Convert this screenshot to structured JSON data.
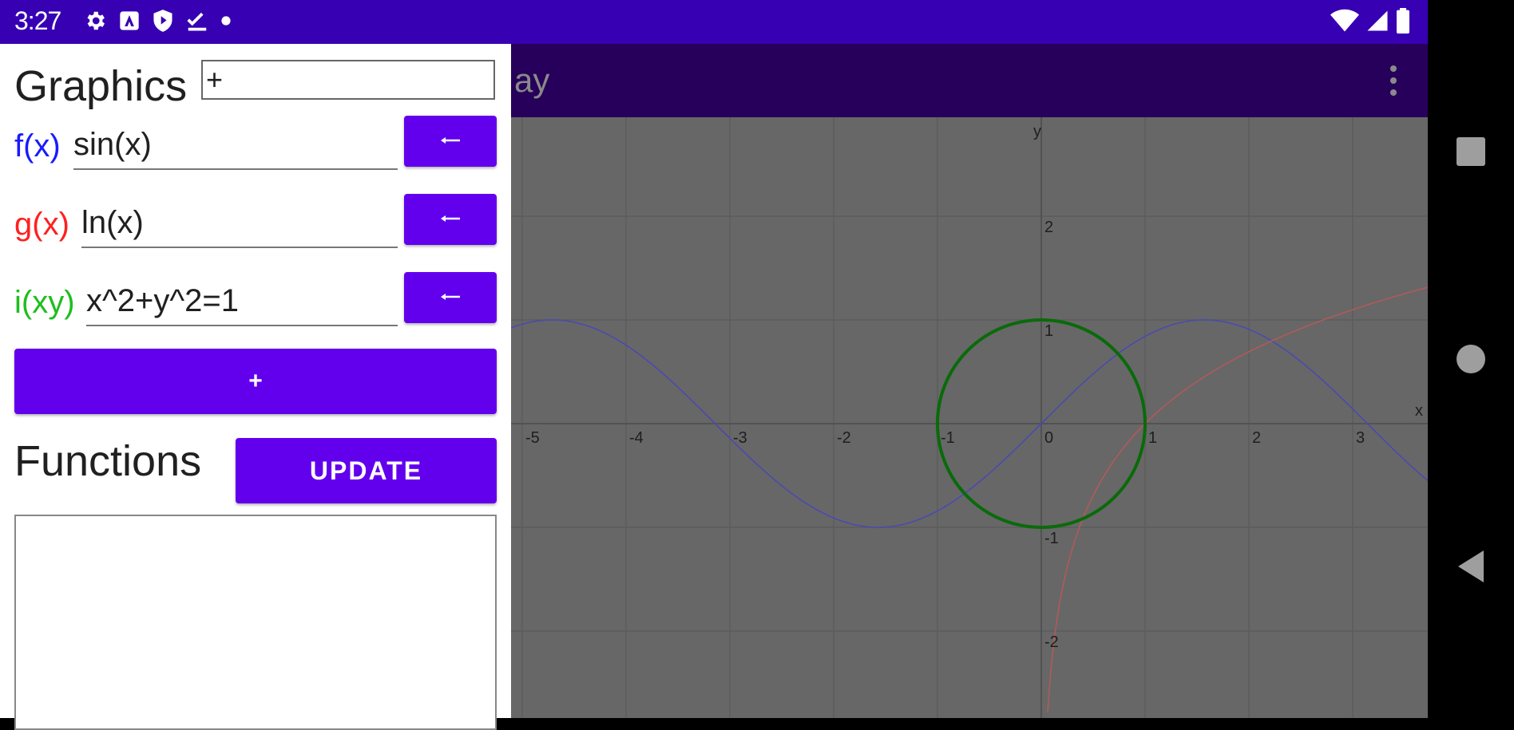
{
  "status_bar": {
    "time": "3:27",
    "left_icons": [
      "settings-icon",
      "a-badge-icon",
      "shield-play-icon",
      "check-download-icon",
      "dot-icon"
    ],
    "right_icons": [
      "wifi-icon",
      "signal-icon",
      "battery-icon"
    ]
  },
  "app_bar": {
    "title_partial": "ay",
    "menu_icon": "overflow-menu-icon"
  },
  "drawer": {
    "graphics_label": "Graphics",
    "graphics_input_value": "+",
    "functions": [
      {
        "name": "f(x)",
        "expression": "sin(x)",
        "color": "#1a1aff",
        "button_icon": "arrow-left-icon"
      },
      {
        "name": "g(x)",
        "expression": "ln(x)",
        "color": "#ff2020",
        "button_icon": "arrow-left-icon"
      },
      {
        "name": "i(xy)",
        "expression": "x^2+y^2=1",
        "color": "#1ebe1e",
        "button_icon": "arrow-left-icon"
      }
    ],
    "add_button_label": "+",
    "functions_heading": "Functions",
    "update_button_label": "UPDATE"
  },
  "graph": {
    "x_axis_label": "x",
    "y_axis_label": "y",
    "x_tick_labels": [
      "-5",
      "-4",
      "-3",
      "-2",
      "-1",
      "0",
      "1",
      "2",
      "3"
    ],
    "y_tick_labels": [
      "2",
      "1",
      "-1",
      "-2"
    ],
    "x_ticks": [
      -5,
      -4,
      -3,
      -2,
      -1,
      0,
      1,
      2,
      3
    ],
    "y_ticks": [
      2,
      1,
      -1,
      -2
    ],
    "x_range": [
      -5.1,
      3.8
    ],
    "y_range": [
      -2.9,
      2.9
    ],
    "curves": [
      {
        "expression": "sin(x)",
        "color": "#4a4ab0"
      },
      {
        "expression": "ln(x)",
        "color": "#b05a5a"
      },
      {
        "expression": "x^2+y^2=1",
        "color": "#0a6a0a"
      }
    ],
    "background": "#676767",
    "grid_color": "#5a5a5a"
  },
  "nav_bar": {
    "buttons": [
      "recents-square-icon",
      "home-circle-icon",
      "back-triangle-icon"
    ]
  },
  "colors": {
    "status_bar": "#3700b3",
    "app_bar": "#26005a",
    "accent": "#6200ee"
  }
}
